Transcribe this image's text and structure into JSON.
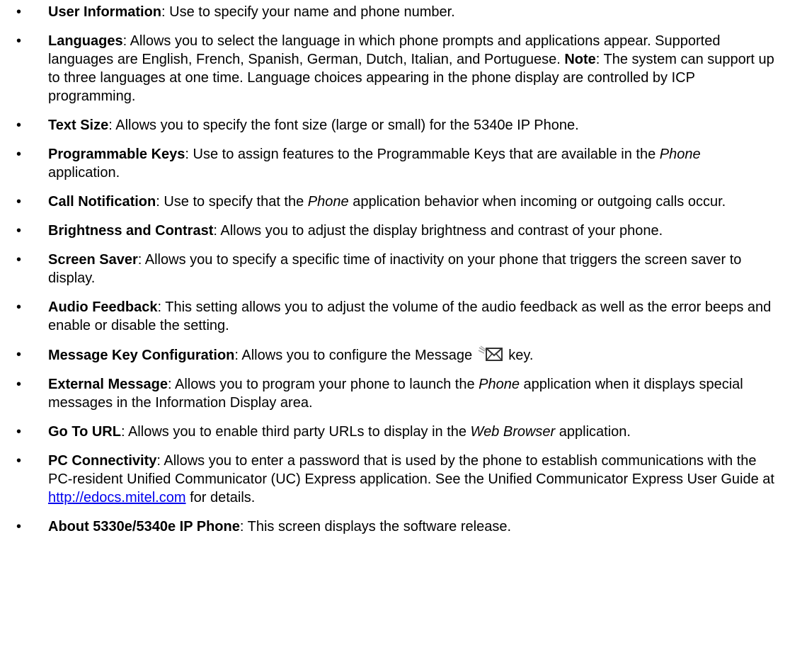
{
  "items": [
    {
      "title": "User Information",
      "after_title": ": Use to specify your name and phone number."
    },
    {
      "title": "Languages",
      "after_title": ": Allows you to select the language in which phone prompts and applications appear. Supported languages are English, French, Spanish, German, Dutch, Italian, and Portuguese. ",
      "note_label": "Note",
      "note_text": ": The system can support up to three languages at one time. Language choices appearing in the phone display are controlled by ICP programming."
    },
    {
      "title": "Text Size",
      "after_title": ": Allows you to specify the font size (large or small) for the 5340e IP Phone."
    },
    {
      "title": "Programmable Keys",
      "after_title": ": Use to assign features to the Programmable Keys that are available in the ",
      "em": "Phone",
      "after_em": " application."
    },
    {
      "title": "Call Notification",
      "after_title": ": Use to specify that the ",
      "em": "Phone",
      "after_em": " application behavior when incoming or outgoing calls occur."
    },
    {
      "title": "Brightness and Contrast",
      "after_title": ": Allows you to adjust the display brightness and contrast of your phone."
    },
    {
      "title": "Screen Saver",
      "after_title": ": Allows you to specify a specific time of inactivity on your phone that triggers the screen saver to display."
    },
    {
      "title": "Audio Feedback",
      "after_title": ": This setting allows you to adjust the volume of the audio feedback as well as the error beeps and enable or disable the setting."
    },
    {
      "title": "Message Key Configuration",
      "after_title": ": Allows you to configure the Message ",
      "after_icon": " key.",
      "icon": "message-envelope-icon"
    },
    {
      "title": "External Message",
      "after_title": ": Allows you to program your phone to launch the ",
      "em": "Phone",
      "after_em": " application when it displays special messages in the Information Display area."
    },
    {
      "title": "Go To URL",
      "after_title": ": Allows you to enable third party URLs to display in the ",
      "em": "Web Browser",
      "after_em": " application."
    },
    {
      "title": "PC Connectivity",
      "after_title": ": Allows you to enter a password that is used by the phone to establish communications with the PC-resident Unified Communicator (UC) Express application. See the Unified Communicator Express User Guide at ",
      "link": "http://edocs.mitel.com",
      "after_link": " for details."
    },
    {
      "title": "About 5330e/5340e IP Phone",
      "after_title": ": This screen displays the software release."
    }
  ],
  "bullet_glyph": "•",
  "link_color": "#0000ee"
}
